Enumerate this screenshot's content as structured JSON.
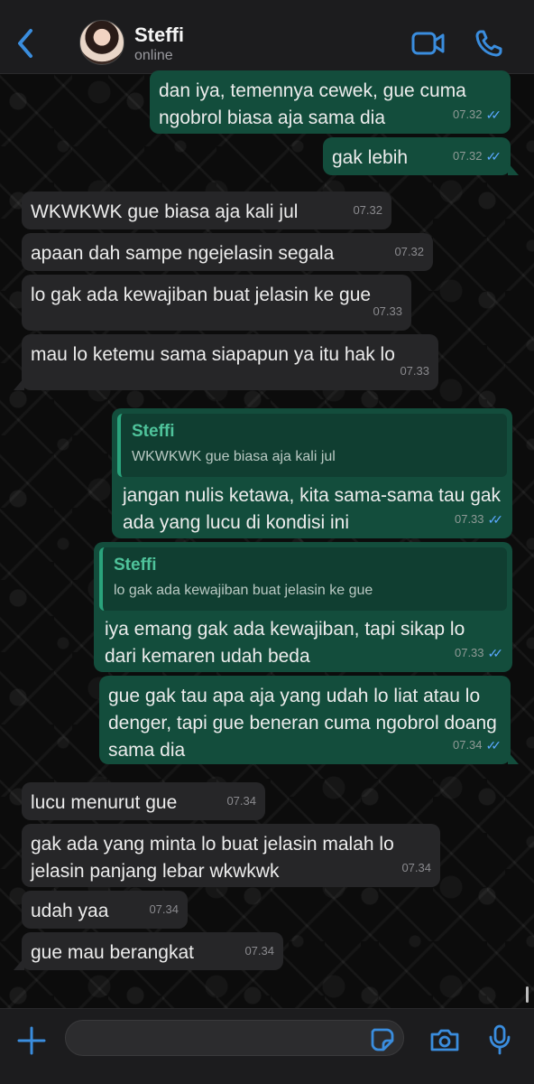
{
  "header": {
    "contact_name": "Steffi",
    "status": "online",
    "accent": "#3a8dde"
  },
  "messages": [
    {
      "direction": "out",
      "text": "dan iya, temennya cewek, gue cuma ngobrol biasa aja sama dia",
      "time": "07.32",
      "read": true
    },
    {
      "direction": "out",
      "text": "gak lebih",
      "time": "07.32",
      "read": true
    },
    {
      "direction": "in",
      "text": "WKWKWK gue biasa aja kali jul",
      "time": "07.32"
    },
    {
      "direction": "in",
      "text": "apaan dah sampe ngejelasin segala",
      "time": "07.32"
    },
    {
      "direction": "in",
      "text": "lo gak ada kewajiban buat jelasin ke gue",
      "time": "07.33"
    },
    {
      "direction": "in",
      "text": "mau lo ketemu sama siapapun ya itu hak lo",
      "time": "07.33"
    },
    {
      "direction": "out",
      "reply_to": {
        "name": "Steffi",
        "text": "WKWKWK gue biasa aja kali jul"
      },
      "text": "jangan nulis ketawa, kita sama-sama tau gak ada yang lucu di kondisi ini",
      "time": "07.33",
      "read": true
    },
    {
      "direction": "out",
      "reply_to": {
        "name": "Steffi",
        "text": "lo gak ada kewajiban buat jelasin ke gue"
      },
      "text": "iya emang gak ada kewajiban, tapi sikap lo dari kemaren udah beda",
      "time": "07.33",
      "read": true
    },
    {
      "direction": "out",
      "text": "gue gak tau apa aja yang udah lo liat atau lo denger, tapi gue beneran cuma ngobrol doang sama dia",
      "time": "07.34",
      "read": true
    },
    {
      "direction": "in",
      "text": "lucu menurut gue",
      "time": "07.34"
    },
    {
      "direction": "in",
      "text": "gak ada yang minta lo buat jelasin malah lo jelasin panjang lebar wkwkwk",
      "time": "07.34"
    },
    {
      "direction": "in",
      "text": "udah yaa",
      "time": "07.34"
    },
    {
      "direction": "in",
      "text": "gue mau berangkat",
      "time": "07.34"
    }
  ],
  "composer": {
    "value": "",
    "placeholder": ""
  },
  "icons": {
    "back": "chevron-left-icon",
    "video": "video-call-icon",
    "call": "phone-icon",
    "attach": "plus-icon",
    "sticker": "sticker-icon",
    "camera": "camera-icon",
    "mic": "microphone-icon"
  },
  "colors": {
    "bubble_out": "#134d3c",
    "bubble_in": "#262628",
    "read_ticks": "#5aa8ff",
    "quote_name": "#4fc39b"
  }
}
